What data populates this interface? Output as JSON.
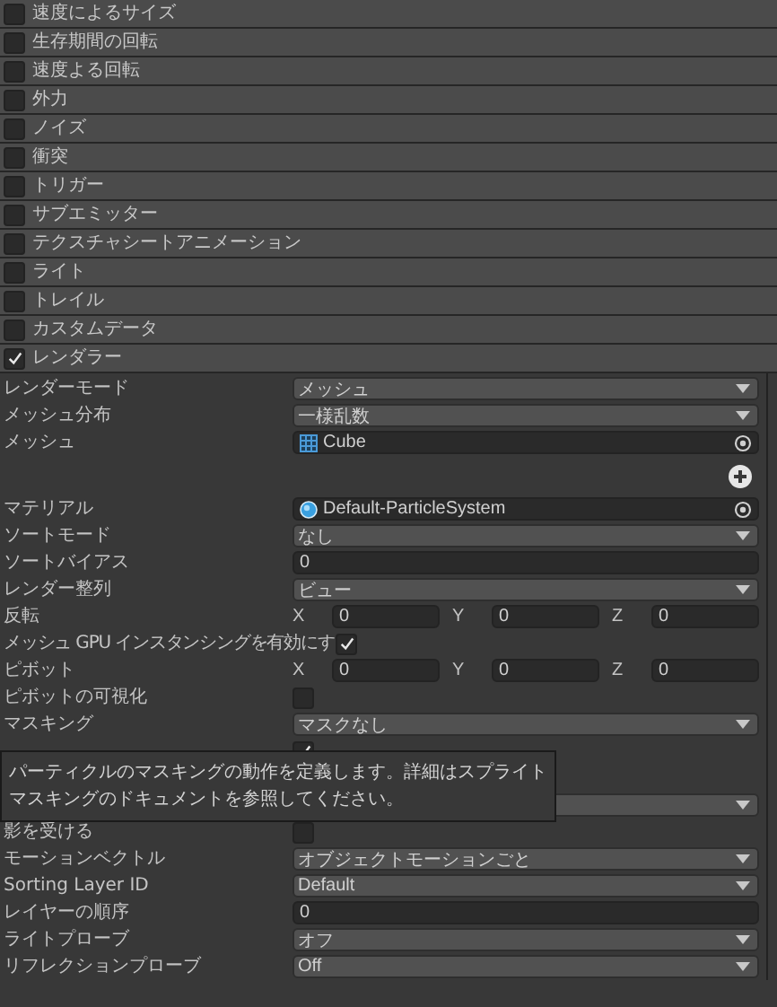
{
  "modules": [
    {
      "label": "速度によるサイズ",
      "checked": false
    },
    {
      "label": "生存期間の回転",
      "checked": false
    },
    {
      "label": "速度よる回転",
      "checked": false
    },
    {
      "label": "外力",
      "checked": false
    },
    {
      "label": "ノイズ",
      "checked": false
    },
    {
      "label": "衝突",
      "checked": false
    },
    {
      "label": "トリガー",
      "checked": false
    },
    {
      "label": "サブエミッター",
      "checked": false
    },
    {
      "label": "テクスチャシートアニメーション",
      "checked": false
    },
    {
      "label": "ライト",
      "checked": false
    },
    {
      "label": "トレイル",
      "checked": false
    },
    {
      "label": "カスタムデータ",
      "checked": false
    },
    {
      "label": "レンダラー",
      "checked": true
    }
  ],
  "rows": [
    {
      "kind": "dropdown",
      "label": "レンダーモード",
      "value": "メッシュ"
    },
    {
      "kind": "dropdown",
      "label": "メッシュ分布",
      "value": "一様乱数"
    },
    {
      "kind": "mesh",
      "label": "メッシュ",
      "value": "Cube"
    },
    {
      "kind": "add"
    },
    {
      "kind": "material",
      "label": "マテリアル",
      "value": "Default-ParticleSystem"
    },
    {
      "kind": "dropdown",
      "label": "ソートモード",
      "value": "なし"
    },
    {
      "kind": "number",
      "label": "ソートバイアス",
      "value": "0"
    },
    {
      "kind": "dropdown",
      "label": "レンダー整列",
      "value": "ビュー"
    },
    {
      "kind": "vector",
      "label": "反転",
      "components": [
        {
          "axis": "X",
          "value": "0"
        },
        {
          "axis": "Y",
          "value": "0"
        },
        {
          "axis": "Z",
          "value": "0"
        }
      ]
    },
    {
      "kind": "checkbox",
      "label": "メッシュ GPU インスタンシングを有効にす",
      "checked": true
    },
    {
      "kind": "vector",
      "label": "ピボット",
      "components": [
        {
          "axis": "X",
          "value": "0"
        },
        {
          "axis": "Y",
          "value": "0"
        },
        {
          "axis": "Z",
          "value": "0"
        }
      ]
    },
    {
      "kind": "checkbox",
      "label": "ピボットの可視化",
      "checked": false
    },
    {
      "kind": "dropdown",
      "label": "マスキング",
      "value": "マスクなし"
    },
    {
      "kind": "checkbox",
      "checked": true
    },
    {
      "kind": "gap"
    },
    {
      "kind": "dropdown"
    },
    {
      "kind": "checkbox",
      "label": "影を受ける",
      "checked": false
    },
    {
      "kind": "dropdown",
      "label": "モーションベクトル",
      "value": "オブジェクトモーションごと"
    },
    {
      "kind": "dropdown",
      "label": "Sorting Layer ID",
      "value": "Default"
    },
    {
      "kind": "number",
      "label": "レイヤーの順序",
      "value": "0"
    },
    {
      "kind": "dropdown",
      "label": "ライトプローブ",
      "value": "オフ"
    },
    {
      "kind": "dropdown",
      "label": "リフレクションプローブ",
      "value": "Off"
    }
  ],
  "tooltip": {
    "lines": [
      "パーティクルのマスキングの動作を定義します。詳細はスプライト",
      "マスキングのドキュメントを参照してください。"
    ]
  }
}
